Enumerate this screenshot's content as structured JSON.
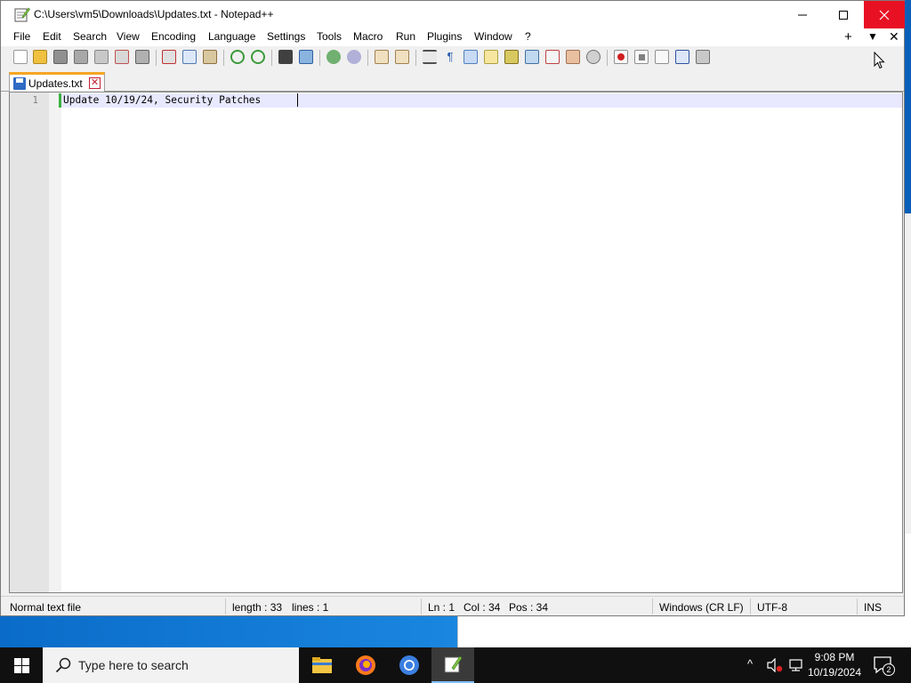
{
  "window": {
    "title": "C:\\Users\\vm5\\Downloads\\Updates.txt - Notepad++",
    "min_symbol": "—",
    "max_symbol": "☐",
    "close_symbol": "✕"
  },
  "menubar": {
    "items": [
      "File",
      "Edit",
      "Search",
      "View",
      "Encoding",
      "Language",
      "Settings",
      "Tools",
      "Macro",
      "Run",
      "Plugins",
      "Window",
      "?"
    ],
    "plus": "+",
    "down": "▼",
    "close": "✕"
  },
  "toolbar": {
    "icons": [
      "new-file-icon",
      "open-file-icon",
      "save-icon",
      "save-all-icon",
      "close-icon",
      "close-all-icon",
      "print-icon",
      "cut-icon",
      "copy-icon",
      "paste-icon",
      "undo-icon",
      "redo-icon",
      "find-icon",
      "replace-icon",
      "zoom-in-icon",
      "zoom-out-icon",
      "sync-vertical-icon",
      "sync-horizontal-icon",
      "word-wrap-icon",
      "show-all-chars-icon",
      "indent-guide-icon",
      "user-defined-language-icon",
      "document-map-icon",
      "function-list-icon",
      "folder-as-workspace-icon",
      "monitoring-icon",
      "record-macro-icon",
      "stop-recording-icon",
      "playback-macro-icon",
      "run-macro-multiple-icon",
      "save-macro-icon"
    ]
  },
  "tab": {
    "label": "Updates.txt",
    "close": "✕"
  },
  "editor": {
    "line_number": "1",
    "line_text": "Update 10/19/24, Security Patches"
  },
  "statusbar": {
    "file_type": "Normal text file",
    "length": "length : 33",
    "lines": "lines : 1",
    "ln": "Ln : 1",
    "col": "Col : 34",
    "pos": "Pos : 34",
    "eol": "Windows (CR LF)",
    "encoding": "UTF-8",
    "mode": "INS"
  },
  "taskbar": {
    "search_placeholder": "Type here to search",
    "apps": [
      "file-explorer-icon",
      "firefox-icon",
      "chrome-icon",
      "notepad-plus-plus-icon"
    ],
    "time": "9:08 PM",
    "date": "10/19/2024",
    "notification_count": "2"
  },
  "colors": {
    "close_hover": "#e81123",
    "tab_accent": "#f5a623",
    "current_line": "#e8e8ff",
    "taskbar": "#101010"
  }
}
